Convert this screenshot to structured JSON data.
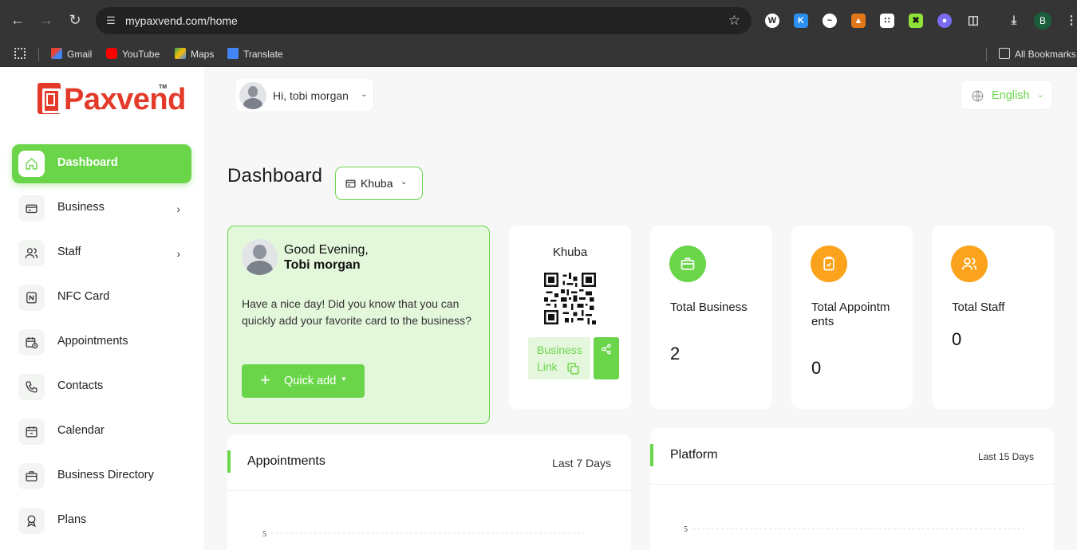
{
  "browser": {
    "url": "mypaxvend.com/home",
    "bookmarks": [
      "Gmail",
      "YouTube",
      "Maps",
      "Translate"
    ],
    "all_bookmarks": "All Bookmarks",
    "profile_initial": "B"
  },
  "logo": {
    "text": "Paxvend",
    "tm": "TM"
  },
  "sidebar": {
    "items": [
      {
        "label": "Dashboard",
        "icon": "home-icon",
        "active": true
      },
      {
        "label": "Business",
        "icon": "card-icon",
        "has_submenu": true
      },
      {
        "label": "Staff",
        "icon": "users-icon",
        "has_submenu": true
      },
      {
        "label": "NFC Card",
        "icon": "nfc-card-icon"
      },
      {
        "label": "Appointments",
        "icon": "calendar-clock-icon"
      },
      {
        "label": "Contacts",
        "icon": "phone-icon"
      },
      {
        "label": "Calendar",
        "icon": "calendar-icon"
      },
      {
        "label": "Business Directory",
        "icon": "briefcase-icon"
      },
      {
        "label": "Plans",
        "icon": "badge-icon"
      }
    ]
  },
  "header": {
    "greeting": "Hi, tobi morgan",
    "language": "English"
  },
  "page": {
    "title": "Dashboard",
    "business_select": "Khuba"
  },
  "welcome": {
    "line1": "Good Evening,",
    "line2": "Tobi morgan",
    "message": "Have a nice day! Did you know that you can quickly add your favorite card to the business?",
    "quick_add": "Quick add"
  },
  "qr_card": {
    "title": "Khuba",
    "link_line1": "Business",
    "link_line2": "Link"
  },
  "stats": [
    {
      "label": "Total Business",
      "value": "2",
      "color": "#6bd54a",
      "icon": "briefcase-icon"
    },
    {
      "label": "Total Appointments",
      "value": "0",
      "color": "#fba31c",
      "icon": "clipboard-icon"
    },
    {
      "label": "Total Staff",
      "value": "0",
      "color": "#fba31c",
      "icon": "users-icon"
    }
  ],
  "panels": {
    "appointments": {
      "title": "Appointments",
      "range": "Last 7 Days"
    },
    "platform": {
      "title": "Platform",
      "range": "Last 15 Days"
    }
  },
  "chart_data": [
    {
      "type": "line",
      "title": "Appointments",
      "y_ticks": [
        "5"
      ],
      "grid": true
    },
    {
      "type": "line",
      "title": "Platform",
      "y_ticks": [
        "5"
      ],
      "grid": true
    }
  ],
  "colors": {
    "accent": "#6bd54a",
    "orange": "#fba31c",
    "brand_red": "#e33a2a"
  }
}
